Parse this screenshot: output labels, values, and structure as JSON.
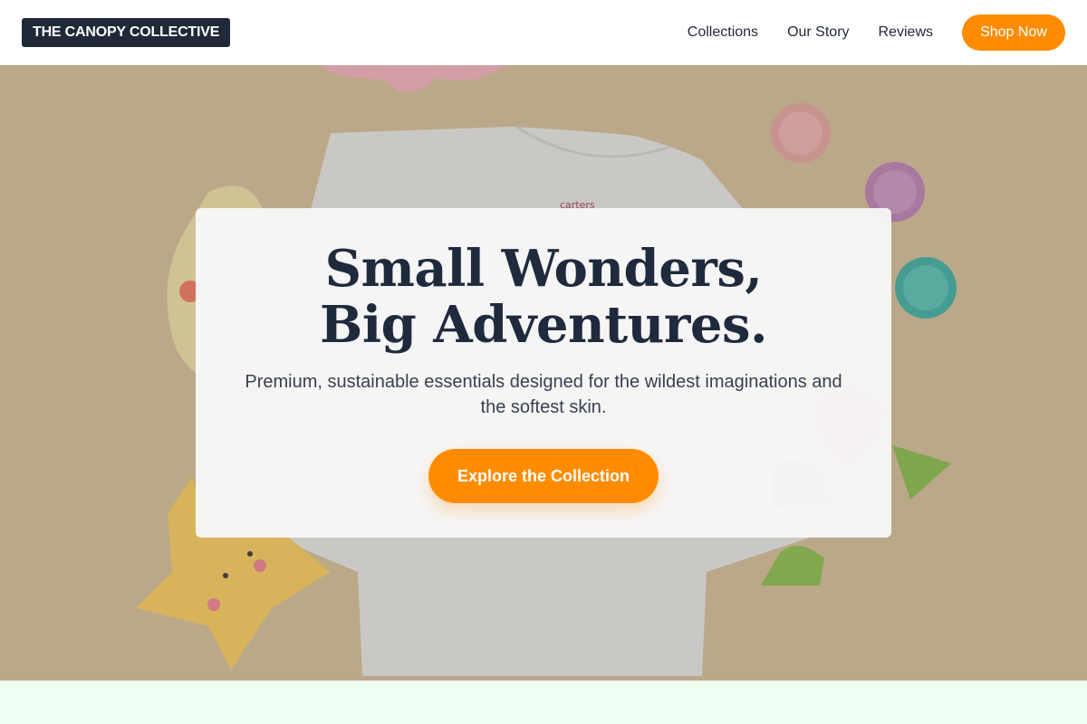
{
  "header": {
    "logo": "THE CANOPY COLLECTIVE",
    "nav": [
      {
        "label": "Collections"
      },
      {
        "label": "Our Story"
      },
      {
        "label": "Reviews"
      }
    ],
    "cta_label": "Shop Now"
  },
  "hero": {
    "headline": "Small Wonders, Big Adventures.",
    "subtitle": "Premium, sustainable essentials designed for the wildest imaginations and the softest skin.",
    "cta_label": "Explore the Collection",
    "shirt_label": "carters"
  },
  "colors": {
    "accent": "#ff8c00",
    "logo_bg": "#1f2937",
    "headline": "#1f2a3d",
    "hero_bg": "#c7b391",
    "strip_bg": "#effff3"
  },
  "icons": {
    "hero_image": "baby-flatlay-photo"
  }
}
